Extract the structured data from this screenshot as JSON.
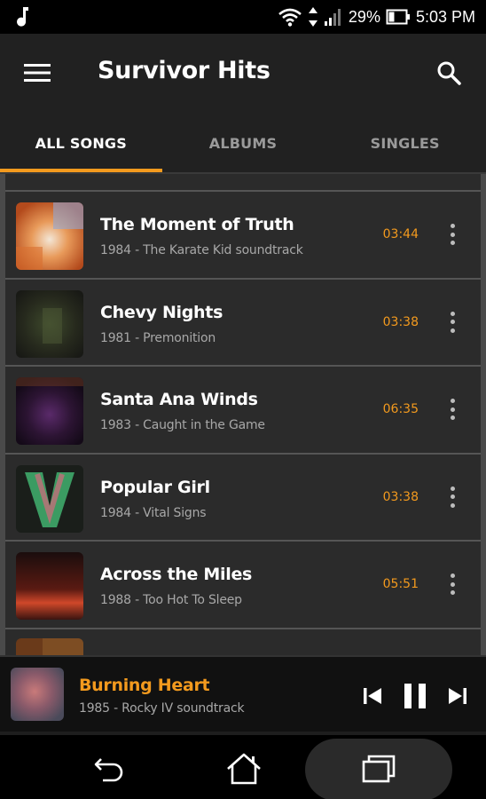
{
  "status_bar": {
    "battery": "29%",
    "time": "5:03 PM",
    "icons": [
      "music-note-icon",
      "wifi-icon",
      "data-arrows-icon",
      "signal-icon",
      "battery-icon"
    ]
  },
  "app_bar": {
    "title": "Survivor Hits",
    "menu_icon": "hamburger-menu-icon",
    "search_icon": "search-icon"
  },
  "tabs": [
    {
      "label": "ALL SONGS",
      "active": true
    },
    {
      "label": "ALBUMS",
      "active": false
    },
    {
      "label": "SINGLES",
      "active": false
    }
  ],
  "songs": [
    {
      "title": "The Moment of Truth",
      "subtitle": "1984 - The Karate Kid soundtrack",
      "duration": "03:44"
    },
    {
      "title": "Chevy Nights",
      "subtitle": "1981 - Premonition",
      "duration": "03:38"
    },
    {
      "title": "Santa Ana Winds",
      "subtitle": "1983 - Caught in the Game",
      "duration": "06:35"
    },
    {
      "title": "Popular Girl",
      "subtitle": "1984 - Vital Signs",
      "duration": "03:38"
    },
    {
      "title": "Across the Miles",
      "subtitle": "1988 - Too Hot To Sleep",
      "duration": "05:51"
    }
  ],
  "now_playing": {
    "title": "Burning Heart",
    "subtitle": "1985 - Rocky IV soundtrack",
    "controls": [
      "skip-previous-icon",
      "pause-icon",
      "skip-next-icon"
    ]
  },
  "nav_bar": {
    "icons": [
      "back-icon",
      "home-icon",
      "recents-icon"
    ]
  },
  "colors": {
    "accent": "#f39a1e",
    "appbar": "#212121",
    "row_bg": "#2b2b2b",
    "subtitle_text": "#a8a8a8"
  }
}
